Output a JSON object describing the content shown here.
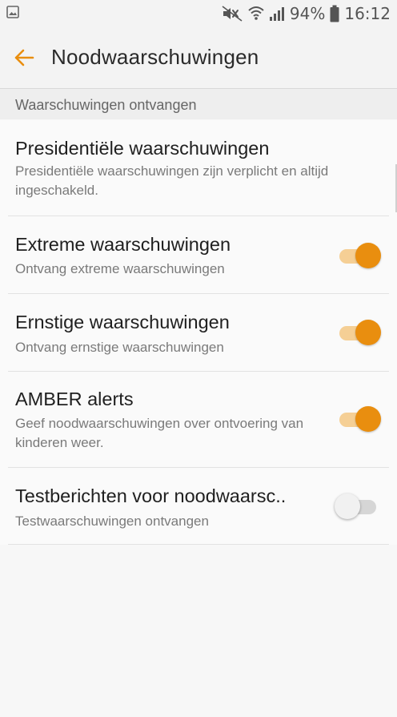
{
  "status_bar": {
    "left_icon": "image-icon",
    "icons": [
      "mute-icon",
      "wifi-icon",
      "signal-icon",
      "battery-icon"
    ],
    "battery": "94%",
    "time": "16:12"
  },
  "app_bar": {
    "back_icon": "back-arrow-icon",
    "title": "Noodwaarschuwingen"
  },
  "section": {
    "header": "Waarschuwingen ontvangen"
  },
  "items": [
    {
      "title": "Presidentiële waarschuwingen",
      "subtitle": "Presidentiële waarschuwingen zijn verplicht en altijd ingeschakeld.",
      "toggle": null
    },
    {
      "title": "Extreme waarschuwingen",
      "subtitle": "Ontvang extreme waarschuwingen",
      "toggle": "on"
    },
    {
      "title": "Ernstige waarschuwingen",
      "subtitle": "Ontvang ernstige waarschuwingen",
      "toggle": "on"
    },
    {
      "title": "AMBER alerts",
      "subtitle": "Geef noodwaarschuwingen over ontvoering van kinderen weer.",
      "toggle": "on"
    },
    {
      "title": "Testberichten voor noodwaarsc..",
      "subtitle": "Testwaarschuwingen ontvangen",
      "toggle": "off"
    }
  ],
  "colors": {
    "accent": "#e98e0f",
    "accent_track": "#f5cf95",
    "off_track": "#d6d6d6",
    "off_thumb": "#f1f1f1"
  }
}
